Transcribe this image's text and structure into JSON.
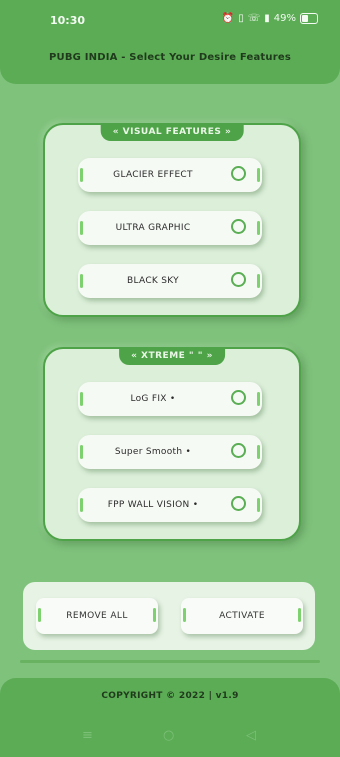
{
  "status_bar": {
    "time": "10:30",
    "icons": [
      "alarm-icon",
      "vibrate-icon",
      "wifi-call-icon",
      "signal-icon",
      "battery-icon"
    ],
    "battery_text": "49%"
  },
  "header": {
    "title": "PUBG INDIA - Select Your Desire Features"
  },
  "visual_panel": {
    "tag": "« VISUAL FEATURES »",
    "items": [
      {
        "label": "GLACIER EFFECT"
      },
      {
        "label": "ULTRA GRAPHIC"
      },
      {
        "label": "BLACK SKY"
      }
    ]
  },
  "xtreme_panel": {
    "tag": "« XTREME \" \" »",
    "items": [
      {
        "label": "LoG FIX •"
      },
      {
        "label": "Super Smooth •"
      },
      {
        "label": "FPP WALL VISION •"
      }
    ]
  },
  "actions": {
    "remove_label": "REMOVE ALL",
    "activate_label": "ACTIVATE"
  },
  "footer": {
    "copyright": "COPYRIGHT ©  2022  |  v1.9"
  },
  "navbar": {
    "menu": "≡",
    "home": "○",
    "back": "◁"
  },
  "colors": {
    "background": "#7fc27c",
    "accent": "#5cac55",
    "panel": "#dcefd9"
  }
}
